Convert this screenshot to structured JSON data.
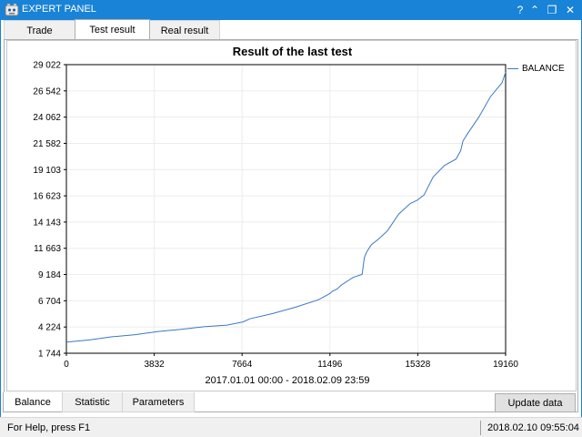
{
  "window": {
    "title": "EXPERT PANEL",
    "controls": {
      "help": "?",
      "minimize": "⌃",
      "restore": "❐",
      "close": "✕"
    }
  },
  "top_tabs": [
    {
      "label": "Trade",
      "active": false
    },
    {
      "label": "Test result",
      "active": true
    },
    {
      "label": "Real result",
      "active": false
    }
  ],
  "bottom_tabs": [
    {
      "label": "Balance",
      "active": true
    },
    {
      "label": "Statistic",
      "active": false
    },
    {
      "label": "Parameters",
      "active": false
    }
  ],
  "update_button": "Update data",
  "status": {
    "help_text": "For Help, press F1",
    "datetime": "2018.02.10 09:55:04"
  },
  "colors": {
    "titlebar": "#1883d7",
    "series": "#3a78c4"
  },
  "chart_data": {
    "type": "line",
    "title": "Result of the last test",
    "xlabel": "2017.01.01 00:00 - 2018.02.09 23:59",
    "ylabel": "",
    "xlim": [
      0,
      19160
    ],
    "ylim": [
      1744,
      29022
    ],
    "x_ticks": [
      "0",
      "3832",
      "7664",
      "11496",
      "15328",
      "19160"
    ],
    "y_ticks": [
      "29 022",
      "26 542",
      "24 062",
      "21 582",
      "19 103",
      "16 623",
      "14 143",
      "11 663",
      "9 184",
      "6 704",
      "4 224",
      "1 744"
    ],
    "grid": true,
    "legend_position": "right",
    "series": [
      {
        "name": "BALANCE",
        "x": [
          0,
          1000,
          2000,
          3000,
          4000,
          5000,
          6000,
          7000,
          7700,
          8000,
          9000,
          10000,
          11000,
          11500,
          11600,
          11800,
          12000,
          12500,
          12900,
          13000,
          13100,
          13300,
          13600,
          14000,
          14500,
          15000,
          15300,
          15600,
          16000,
          16500,
          17000,
          17200,
          17300,
          17500,
          18000,
          18500,
          19000,
          19160
        ],
        "y": [
          2800,
          3000,
          3300,
          3500,
          3800,
          4000,
          4250,
          4400,
          4700,
          5000,
          5500,
          6100,
          6800,
          7400,
          7600,
          7800,
          8200,
          8900,
          9200,
          10800,
          11300,
          12000,
          12500,
          13300,
          14900,
          15900,
          16200,
          16700,
          18400,
          19500,
          20100,
          20900,
          21800,
          22500,
          24100,
          26000,
          27300,
          28300
        ]
      }
    ]
  }
}
